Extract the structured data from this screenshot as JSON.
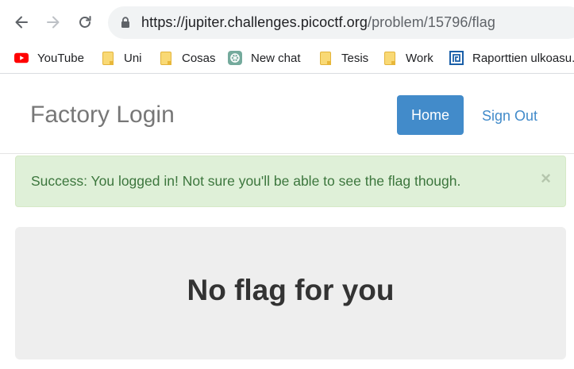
{
  "browser": {
    "url_host": "https://jupiter.challenges.picoctf.org",
    "url_path": "/problem/15796/flag"
  },
  "bookmarks": [
    {
      "label": "YouTube",
      "icon": "youtube-icon"
    },
    {
      "label": "Uni",
      "icon": "folder-icon"
    },
    {
      "label": "Cosas",
      "icon": "folder-icon"
    },
    {
      "label": "New chat",
      "icon": "chatgpt-icon"
    },
    {
      "label": "Tesis",
      "icon": "folder-icon"
    },
    {
      "label": "Work",
      "icon": "folder-icon"
    },
    {
      "label": "Raporttien ulkoasu...",
      "icon": "report-icon"
    }
  ],
  "page": {
    "brand": "Factory Login",
    "nav": {
      "home": "Home",
      "signout": "Sign Out"
    },
    "alert": {
      "text": "Success: You logged in! Not sure you'll be able to see the flag though.",
      "close": "×"
    },
    "jumbotron": {
      "title": "No flag for you"
    }
  },
  "colors": {
    "primary": "#428bca",
    "alert_bg": "#dff0d8",
    "alert_text": "#3c763d",
    "jumbotron_bg": "#eeeeee"
  }
}
